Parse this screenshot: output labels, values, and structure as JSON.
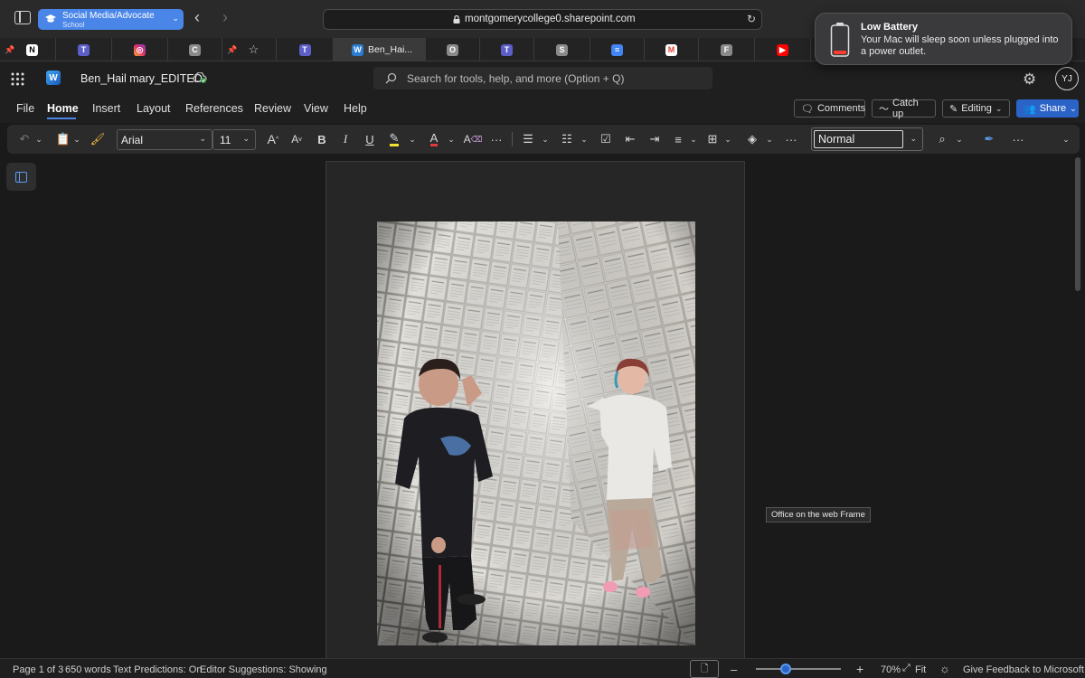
{
  "browser": {
    "tab_group_title": "Social Media/Advocate",
    "tab_group_subtitle": "School",
    "url": "montgomerycollege0.sharepoint.com",
    "pinned_tabs": [
      {
        "letter": "",
        "color": "#ffffff",
        "icon": "pin-icon"
      },
      {
        "letter": "",
        "color": "#5b5fc7",
        "icon": "teams-icon"
      },
      {
        "letter": "",
        "color": "#e1306c",
        "icon": "instagram-icon"
      },
      {
        "letter": "C",
        "color": "#8a8a8a",
        "icon": "c-icon"
      },
      {
        "letter": "",
        "color": "#cccccc",
        "icon": "star-icon"
      },
      {
        "letter": "",
        "color": "#5b5fc7",
        "icon": "teams-icon"
      },
      {
        "letter": "Ben_Hai...",
        "color": "#2b7cd3",
        "icon": "word-icon"
      },
      {
        "letter": "O",
        "color": "#8a8a8a",
        "icon": "o-icon"
      },
      {
        "letter": "",
        "color": "#5b5fc7",
        "icon": "teams-icon"
      },
      {
        "letter": "S",
        "color": "#8a8a8a",
        "icon": "s-icon"
      },
      {
        "letter": "",
        "color": "#4285f4",
        "icon": "docs-icon"
      },
      {
        "letter": "M",
        "color": "#ea4335",
        "icon": "gmail-icon"
      },
      {
        "letter": "F",
        "color": "#8a8a8a",
        "icon": "f-icon"
      },
      {
        "letter": "",
        "color": "#ff0000",
        "icon": "youtube-icon"
      }
    ],
    "active_tab_label": "Ben_Hai..."
  },
  "notification": {
    "title": "Low Battery",
    "body": "Your Mac will sleep soon unless plugged into a power outlet."
  },
  "word": {
    "doc_title": "Ben_Hail mary_EDITED",
    "search_placeholder": "Search for tools, help, and more (Option + Q)",
    "avatar_initials": "YJ",
    "menu": [
      "File",
      "Home",
      "Insert",
      "Layout",
      "References",
      "Review",
      "View",
      "Help"
    ],
    "active_menu": "Home",
    "comments_label": "Comments",
    "catchup_label": "Catch up",
    "editing_label": "Editing",
    "share_label": "Share",
    "font_name": "Arial",
    "font_size": "11",
    "style_name": "Normal",
    "tooltip": "Office on the web Frame"
  },
  "status": {
    "page": "Page 1 of 3",
    "words": "650 words",
    "predictions": "Text Predictions: On",
    "suggestions": "Editor Suggestions: Showing",
    "zoom_minus": "–",
    "zoom_plus": "+",
    "zoom": "70%",
    "fit": "Fit",
    "feedback": "Give Feedback to Microsoft",
    "zoom_level": 0.35
  },
  "colors": {
    "accent": "#2b63c7",
    "tab_group": "#4a86e8"
  }
}
